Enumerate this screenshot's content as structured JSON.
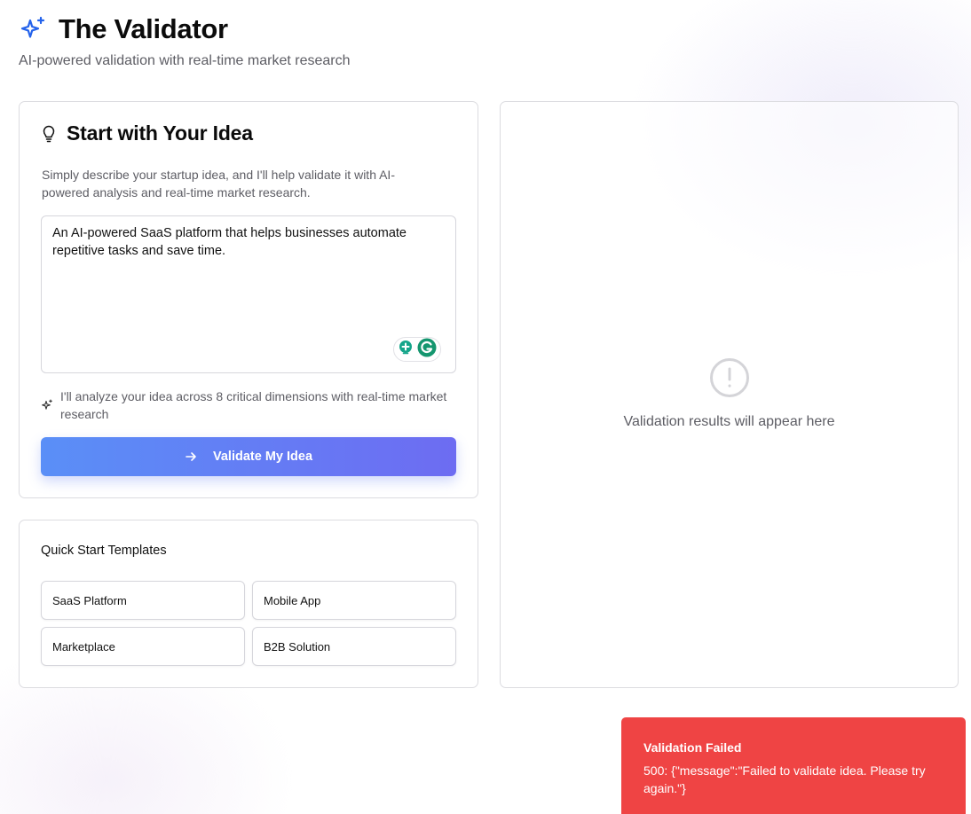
{
  "header": {
    "title": "The Validator",
    "subtitle": "AI-powered validation with real-time market research",
    "logo_icon": "sparkles-icon",
    "accent_color": "#2563eb"
  },
  "idea_card": {
    "title": "Start with Your Idea",
    "title_icon": "lightbulb-icon",
    "description": "Simply describe your startup idea, and I'll help validate it with AI-powered analysis and real-time market research.",
    "textarea_value": "An AI-powered SaaS platform that helps businesses automate repetitive tasks and save time.",
    "hint": "I'll analyze your idea across 8 critical dimensions with real-time market research",
    "hint_icon": "sparkles-icon",
    "validate_button_label": "Validate My Idea",
    "validate_button_icon": "arrow-right-icon",
    "button_gradient": [
      "#5a8ff7",
      "#6d6cf2"
    ]
  },
  "templates": {
    "title": "Quick Start Templates",
    "items": [
      {
        "label": "SaaS Platform"
      },
      {
        "label": "Mobile App"
      },
      {
        "label": "Marketplace"
      },
      {
        "label": "B2B Solution"
      }
    ]
  },
  "results": {
    "placeholder": "Validation results will appear here",
    "icon": "alert-circle-icon"
  },
  "toast": {
    "title": "Validation Failed",
    "message": "500: {\"message\":\"Failed to validate idea. Please try again.\"}",
    "color": "#ef4444"
  }
}
